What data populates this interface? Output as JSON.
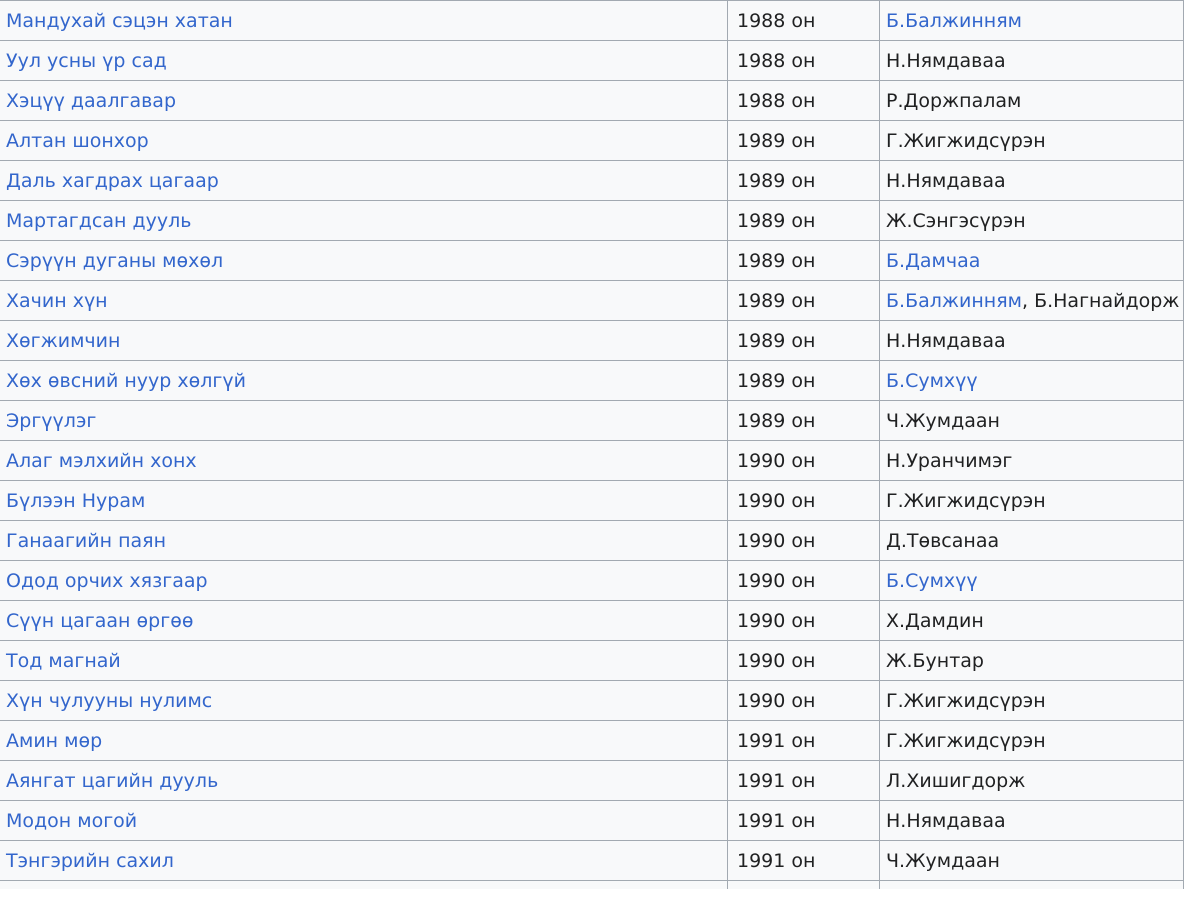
{
  "rows": [
    {
      "title": "Мандухай сэцэн хатан",
      "year": "1988 он",
      "directors": [
        {
          "name": "Б.Балжинням",
          "link": true
        }
      ]
    },
    {
      "title": "Уул усны үр сад",
      "year": "1988 он",
      "directors": [
        {
          "name": "Н.Нямдаваа",
          "link": false
        }
      ]
    },
    {
      "title": "Хэцүү даалгавар",
      "year": "1988 он",
      "directors": [
        {
          "name": "Р.Доржпалам",
          "link": false
        }
      ]
    },
    {
      "title": "Алтан шонхор",
      "year": "1989 он",
      "directors": [
        {
          "name": "Г.Жигжидсүрэн",
          "link": false
        }
      ]
    },
    {
      "title": "Даль хагдрах цагаар",
      "year": "1989 он",
      "directors": [
        {
          "name": "Н.Нямдаваа",
          "link": false
        }
      ]
    },
    {
      "title": "Мартагдсан дууль",
      "year": "1989 он",
      "directors": [
        {
          "name": "Ж.Сэнгэсүрэн",
          "link": false
        }
      ]
    },
    {
      "title": "Сэрүүн дуганы мөхөл",
      "year": "1989 он",
      "directors": [
        {
          "name": "Б.Дамчаа",
          "link": true
        }
      ]
    },
    {
      "title": "Хачин хүн",
      "year": "1989 он",
      "directors": [
        {
          "name": "Б.Балжинням",
          "link": true
        },
        {
          "name": "Б.Нагнайдорж",
          "link": false
        }
      ]
    },
    {
      "title": "Хөгжимчин",
      "year": "1989 он",
      "directors": [
        {
          "name": "Н.Нямдаваа",
          "link": false
        }
      ]
    },
    {
      "title": "Хөх өвсний нуур хөлгүй",
      "year": "1989 он",
      "directors": [
        {
          "name": "Б.Сумхүү",
          "link": true
        }
      ]
    },
    {
      "title": "Эргүүлэг",
      "year": "1989 он",
      "directors": [
        {
          "name": "Ч.Жумдаан",
          "link": false
        }
      ]
    },
    {
      "title": "Алаг мэлхийн хонх",
      "year": "1990 он",
      "directors": [
        {
          "name": "Н.Уранчимэг",
          "link": false
        }
      ]
    },
    {
      "title": "Бүлээн Нурам",
      "year": "1990 он",
      "directors": [
        {
          "name": "Г.Жигжидсүрэн",
          "link": false
        }
      ]
    },
    {
      "title": "Ганаагийн паян",
      "year": "1990 он",
      "directors": [
        {
          "name": "Д.Төвсанаа",
          "link": false
        }
      ]
    },
    {
      "title": "Одод орчих хязгаар",
      "year": "1990 он",
      "directors": [
        {
          "name": "Б.Сумхүү",
          "link": true
        }
      ]
    },
    {
      "title": "Сүүн цагаан өргөө",
      "year": "1990 он",
      "directors": [
        {
          "name": "Х.Дамдин",
          "link": false
        }
      ]
    },
    {
      "title": "Тод магнай",
      "year": "1990 он",
      "directors": [
        {
          "name": "Ж.Бунтар",
          "link": false
        }
      ]
    },
    {
      "title": "Хүн чулууны нулимс",
      "year": "1990 он",
      "directors": [
        {
          "name": "Г.Жигжидсүрэн",
          "link": false
        }
      ]
    },
    {
      "title": "Амин мөр",
      "year": "1991 он",
      "directors": [
        {
          "name": "Г.Жигжидсүрэн",
          "link": false
        }
      ]
    },
    {
      "title": "Аянгат цагийн дууль",
      "year": "1991 он",
      "directors": [
        {
          "name": "Л.Хишигдорж",
          "link": false
        }
      ]
    },
    {
      "title": "Модон могой",
      "year": "1991 он",
      "directors": [
        {
          "name": "Н.Нямдаваа",
          "link": false
        }
      ]
    },
    {
      "title": "Тэнгэрийн сахил",
      "year": "1991 он",
      "directors": [
        {
          "name": "Ч.Жумдаан",
          "link": false
        }
      ]
    }
  ],
  "separator": ", ",
  "colors": {
    "link": "#3366cc",
    "text": "#202122",
    "border": "#a2a9b1",
    "cell_background": "#f8f9fa"
  }
}
